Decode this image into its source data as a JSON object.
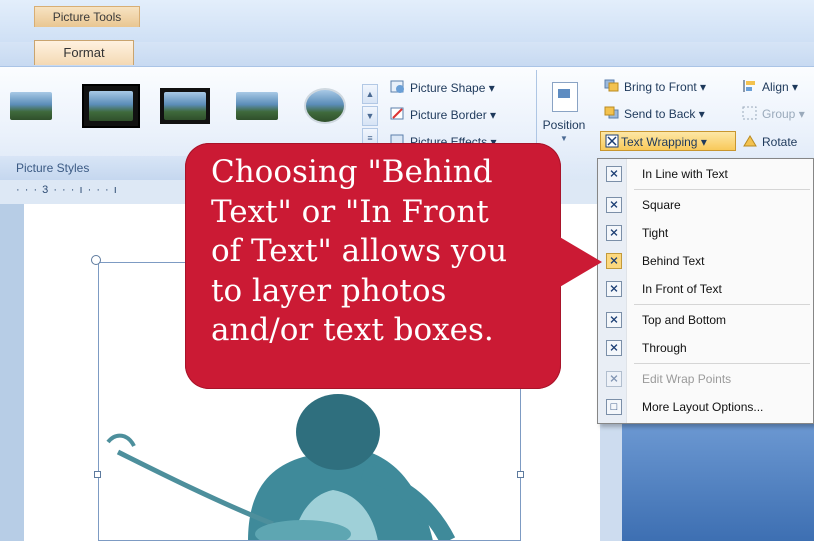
{
  "ribbon": {
    "context_tab": "Picture Tools",
    "active_tab": "Format",
    "group_label": "Picture Styles",
    "commands": {
      "picture_shape": "Picture Shape",
      "picture_border": "Picture Border",
      "picture_effects": "Picture Effects",
      "position": "Position",
      "bring_to_front": "Bring to Front",
      "send_to_back": "Send to Back",
      "text_wrapping": "Text Wrapping",
      "align": "Align",
      "group": "Group",
      "rotate": "Rotate"
    }
  },
  "ruler": {
    "text": "· · · 3 · · · ı · · · ı"
  },
  "wrap_menu": {
    "items": [
      {
        "label": "In Line with Text",
        "enabled": true
      },
      {
        "label": "Square",
        "enabled": true
      },
      {
        "label": "Tight",
        "enabled": true
      },
      {
        "label": "Behind Text",
        "enabled": true,
        "highlighted": true
      },
      {
        "label": "In Front of Text",
        "enabled": true
      },
      {
        "label": "Top and Bottom",
        "enabled": true
      },
      {
        "label": "Through",
        "enabled": true
      },
      {
        "label": "Edit Wrap Points",
        "enabled": false
      },
      {
        "label": "More Layout Options...",
        "enabled": true
      }
    ]
  },
  "callout": {
    "lines": [
      "Choosing \"Behind",
      "Text\" or \"In Front",
      "of Text\" allows you",
      "to layer photos",
      "and/or text boxes."
    ]
  },
  "colors": {
    "callout": "#cb1a34",
    "ribbon_highlight": "#f8c95a",
    "photo_tint": "#3f8a9a"
  },
  "icons": {
    "picture_shape": "picture-shape-icon",
    "picture_border": "picture-border-icon",
    "picture_effects": "picture-effects-icon",
    "bring_to_front": "bring-to-front-icon",
    "send_to_back": "send-to-back-icon",
    "text_wrapping": "text-wrapping-icon",
    "align": "align-icon",
    "group": "group-icon",
    "rotate": "rotate-icon"
  }
}
